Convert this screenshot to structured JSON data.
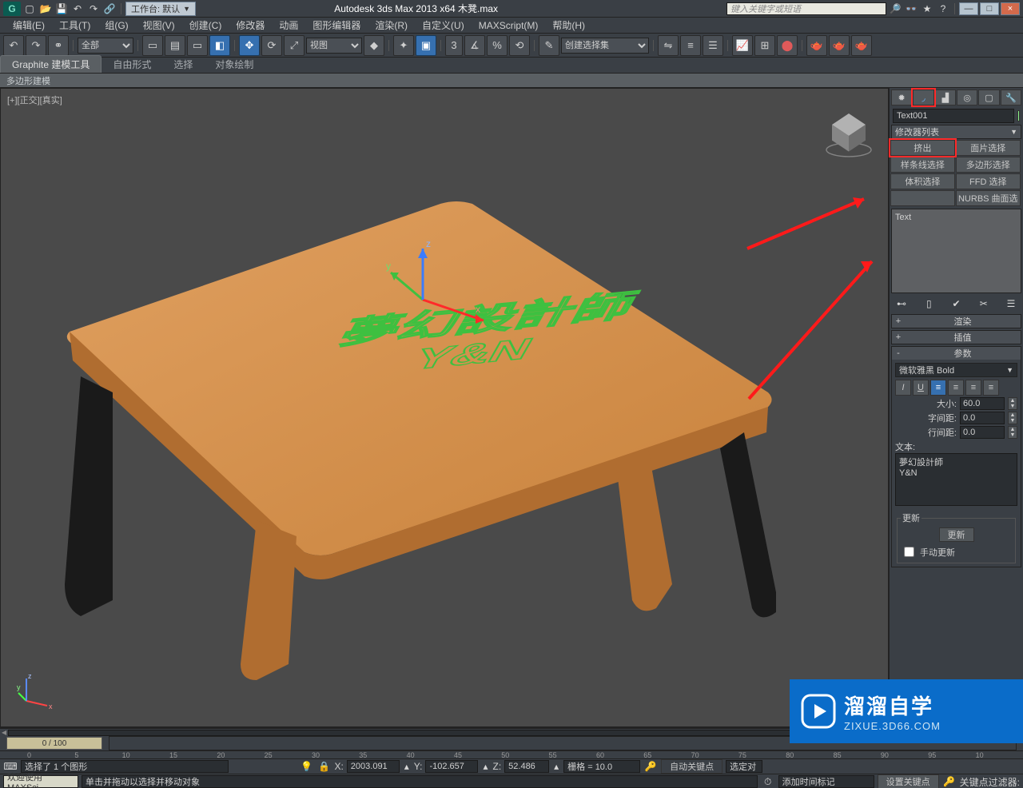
{
  "titlebar": {
    "title_center": "Autodesk 3ds Max  2013 x64    木凳.max",
    "workspace_label": "工作台: 默认",
    "search_placeholder": "键入关键字或短语",
    "min": "—",
    "max": "□",
    "close": "×"
  },
  "menu": [
    "编辑(E)",
    "工具(T)",
    "组(G)",
    "视图(V)",
    "创建(C)",
    "修改器",
    "动画",
    "图形编辑器",
    "渲染(R)",
    "自定义(U)",
    "MAXScript(M)",
    "帮助(H)"
  ],
  "toolbar": {
    "select_filter": "全部",
    "view_mode": "视图",
    "named_sets": "创建选择集"
  },
  "ribbon": {
    "tabs": [
      "Graphite 建模工具",
      "自由形式",
      "选择",
      "对象绘制"
    ],
    "sub": "多边形建模"
  },
  "viewport": {
    "label": "[+][正交][真实]"
  },
  "render_text": {
    "line1": "夢幻設計師",
    "line2": "Y&N"
  },
  "command_panel": {
    "name": "Text001",
    "modlist": "修改器列表",
    "buttons": [
      "挤出",
      "面片选择",
      "样条线选择",
      "多边形选择",
      "体积选择",
      "FFD 选择",
      "",
      "NURBS 曲面选"
    ],
    "stack": "Text",
    "rollouts": {
      "render": "渲染",
      "interp": "插值",
      "params": "参数"
    },
    "font": "微软雅黑 Bold",
    "size_l": "大小:",
    "size_v": "60.0",
    "kerning_l": "字间距:",
    "kerning_v": "0.0",
    "leading_l": "行间距:",
    "leading_v": "0.0",
    "text_l": "文本:",
    "text_v": "夢幻設計師\nY&N",
    "update_title": "更新",
    "update_btn": "更新",
    "manual": "手动更新"
  },
  "timeline": {
    "frame": "0 / 100",
    "ticks": [
      "0",
      "5",
      "10",
      "15",
      "20",
      "25",
      "30",
      "35",
      "40",
      "45",
      "50",
      "55",
      "60",
      "65",
      "70",
      "75",
      "80",
      "85",
      "90",
      "95",
      "10"
    ]
  },
  "status": {
    "sel": "选择了 1 个图形",
    "x_l": "X:",
    "x_v": "2003.091",
    "y_l": "Y:",
    "y_v": "-102.657",
    "z_l": "Z:",
    "z_v": "52.486",
    "grid": "栅格 = 10.0",
    "auto": "自动关键点",
    "seldep": "选定对",
    "prompt": "单击并拖动以选择并移动对象",
    "addtime": "添加时间标记",
    "setkey": "设置关键点",
    "keyfilter": "关键点过滤器:",
    "welcome": "欢迎使用 MAXSci"
  },
  "watermark": {
    "big": "溜溜自学",
    "small": "ZIXUE.3D66.COM"
  }
}
